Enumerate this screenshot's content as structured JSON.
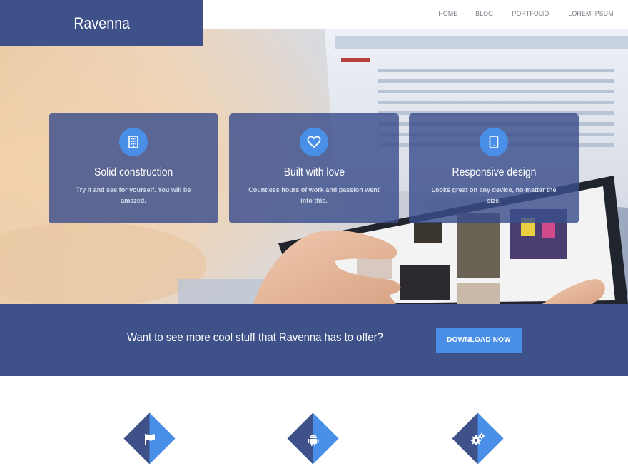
{
  "brand": {
    "name": "Ravenna"
  },
  "nav": {
    "items": [
      "HOME",
      "BLOG",
      "PORTFOLIO",
      "LOREM IPSUM"
    ]
  },
  "hero": {
    "cards": [
      {
        "icon": "building-icon",
        "title": "Solid construction",
        "text": "Try it and see for yourself. You will be amazed."
      },
      {
        "icon": "heart-icon",
        "title": "Built with love",
        "text": "Countless hours of work and passion went into this."
      },
      {
        "icon": "tablet-icon",
        "title": "Responsive design",
        "text": "Looks great on any device, no matter the size."
      }
    ]
  },
  "cta": {
    "text": "Want to see more cool stuff that Ravenna has to offer?",
    "button": "DOWNLOAD NOW"
  },
  "features": {
    "icons": [
      "flag-icon",
      "android-icon",
      "gears-icon"
    ]
  },
  "colors": {
    "primary": "#3e5189",
    "accent": "#4a8fe7",
    "white": "#ffffff"
  }
}
